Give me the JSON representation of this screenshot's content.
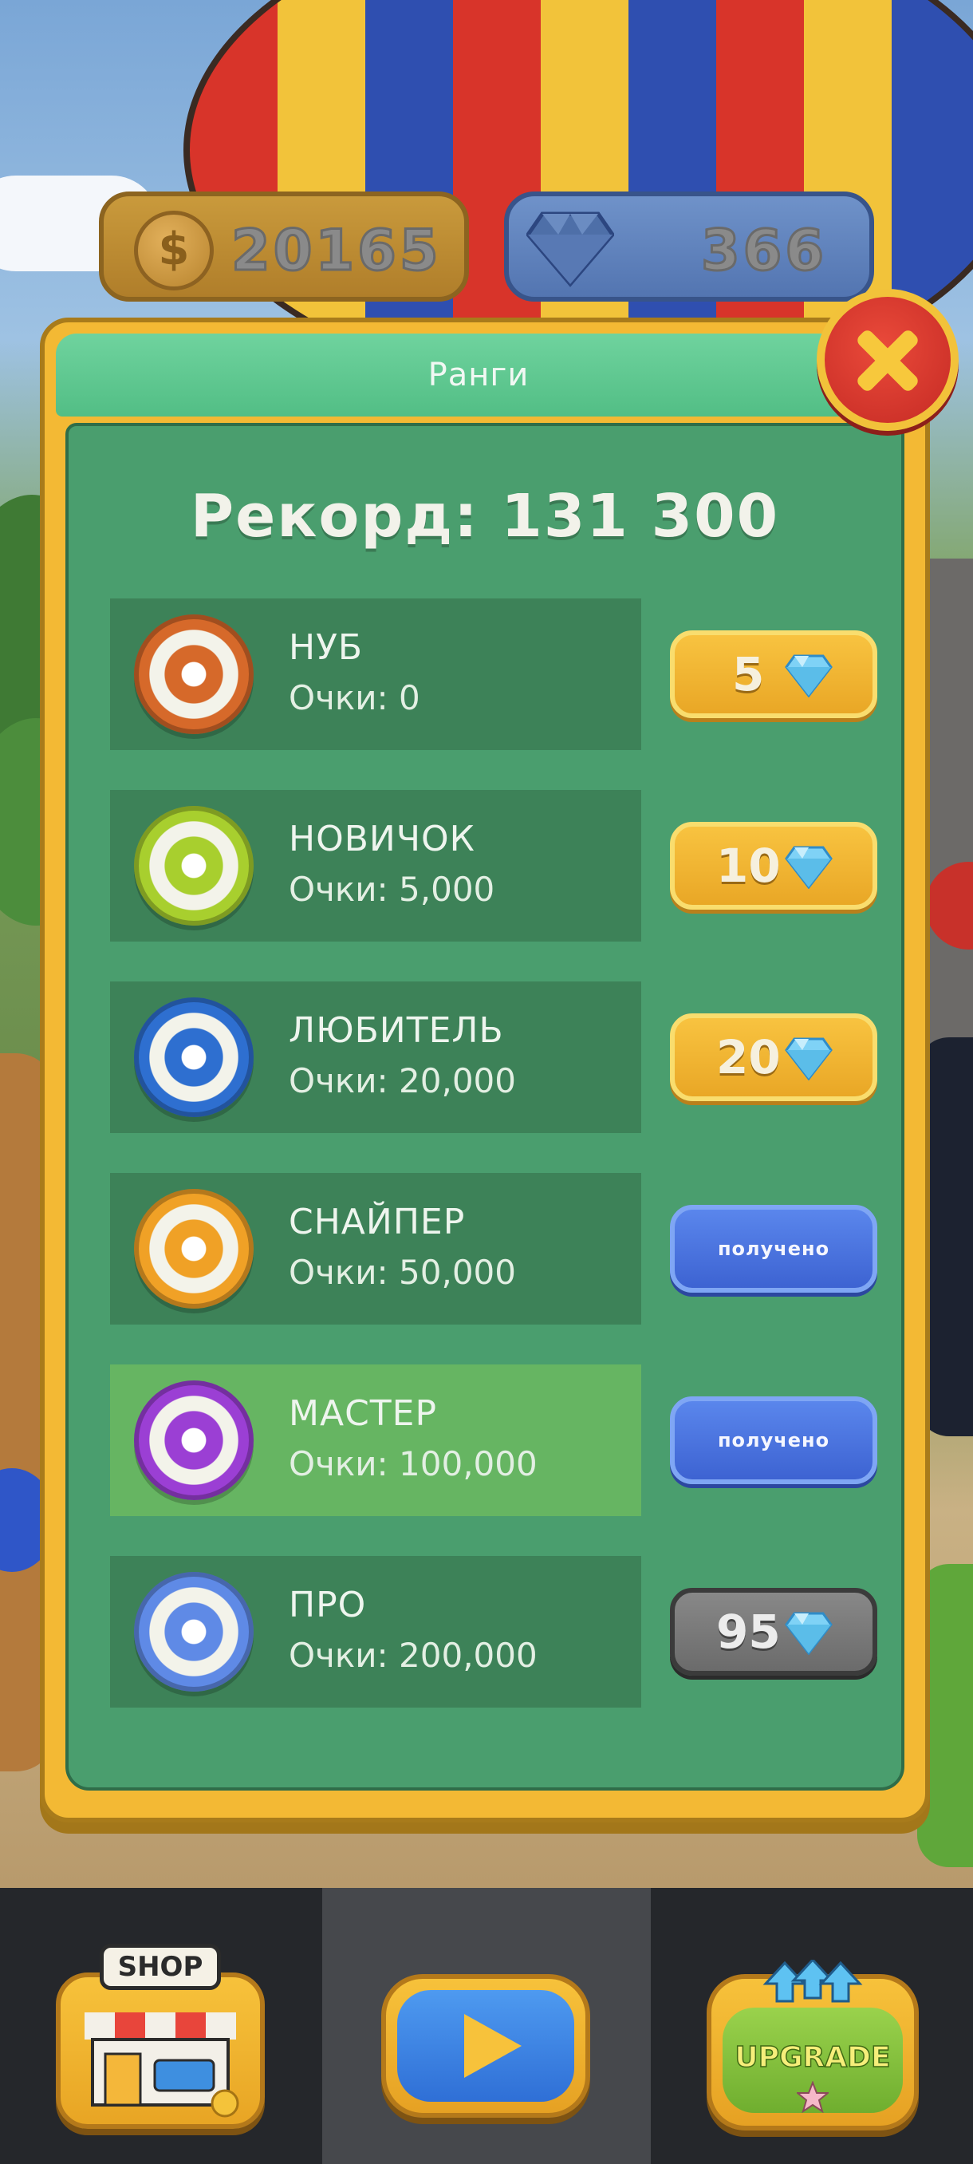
{
  "currency": {
    "coins": "20165",
    "coin_symbol": "$",
    "gems": "366"
  },
  "panel": {
    "title": "Ранги",
    "record": "Рекорд: 131 300"
  },
  "ranks": [
    {
      "name": "НУБ",
      "points": "Очки: 0",
      "reward": "5",
      "state": "gold",
      "badge_color": "#d6692a"
    },
    {
      "name": "НОВИЧОК",
      "points": "Очки: 5,000",
      "reward": "10",
      "state": "gold",
      "badge_color": "#a8cf2e"
    },
    {
      "name": "ЛЮБИТЕЛЬ",
      "points": "Очки: 20,000",
      "reward": "20",
      "state": "gold",
      "badge_color": "#2e6fd0"
    },
    {
      "name": "СНАЙПЕР",
      "points": "Очки: 50,000",
      "reward": "получено",
      "state": "blue",
      "badge_color": "#f0a126"
    },
    {
      "name": "МАСТЕР",
      "points": "Очки: 100,000",
      "reward": "получено",
      "state": "blue",
      "badge_color": "#9b3fd4"
    },
    {
      "name": "ПРО",
      "points": "Очки: 200,000",
      "reward": "95",
      "state": "grey",
      "badge_color": "#5f8ae6"
    }
  ],
  "nav": {
    "shop": "SHOP",
    "upgrade": "UPGRADE"
  },
  "colors": {
    "panel_green": "#4a9e6e",
    "gold": "#f3b934",
    "received_blue": "#3d63d2"
  }
}
